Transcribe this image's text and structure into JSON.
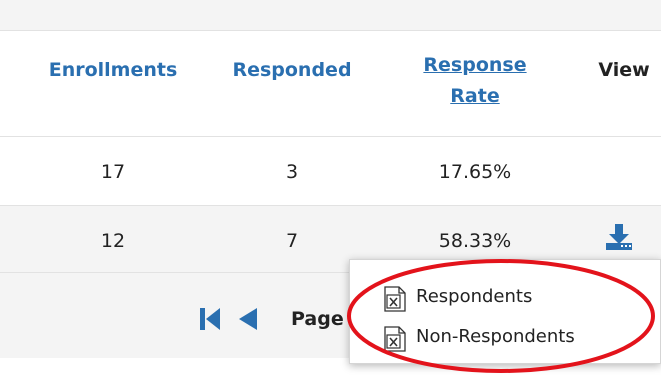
{
  "table": {
    "headers": {
      "enrollments": "Enrollments",
      "responded": "Responded",
      "response_rate_line1": "Response",
      "response_rate_line2": "Rate",
      "view": "View"
    },
    "rows": [
      {
        "enrollments": "17",
        "responded": "3",
        "response_rate": "17.65%"
      },
      {
        "enrollments": "12",
        "responded": "7",
        "response_rate": "58.33%"
      }
    ]
  },
  "pager": {
    "page_label": "Page"
  },
  "download_menu": {
    "items": [
      {
        "label": "Respondents",
        "icon": "excel-file-icon"
      },
      {
        "label": "Non-Respondents",
        "icon": "excel-file-icon"
      }
    ]
  },
  "colors": {
    "header_link": "#2a6fb0",
    "download_icon": "#2a6fb0",
    "pager_arrows": "#2a6fb0",
    "annotation_circle": "#e3131b",
    "row_alt_bg": "#f4f4f4"
  }
}
